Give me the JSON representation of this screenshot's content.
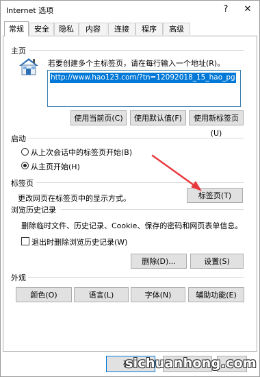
{
  "window": {
    "title": "Internet 选项",
    "help_label": "?",
    "close_label": "✕"
  },
  "tabs": [
    {
      "label": "常规",
      "active": true
    },
    {
      "label": "安全"
    },
    {
      "label": "隐私"
    },
    {
      "label": "内容"
    },
    {
      "label": "连接"
    },
    {
      "label": "程序"
    },
    {
      "label": "高级"
    }
  ],
  "homepage": {
    "section_title": "主页",
    "description": "若要创建多个主标签页，请在每行输入一个地址(R)。",
    "url": "http://www.hao123.com/?tn=12092018_15_hao_pg",
    "buttons": {
      "use_current": "使用当前页(C)",
      "use_default": "使用默认值(F)",
      "use_new_tab": "使用新标签页(U)"
    }
  },
  "startup": {
    "section_title": "启动",
    "options": [
      {
        "label": "从上次会话中的标签页开始(B)",
        "selected": false
      },
      {
        "label": "从主页开始(H)",
        "selected": true
      }
    ]
  },
  "tabs_section": {
    "section_title": "标签页",
    "description": "更改网页在标签页中的显示方式。",
    "button": "标签页(T)"
  },
  "history": {
    "section_title": "浏览历史记录",
    "description": "删除临时文件、历史记录、Cookie、保存的密码和网页表单信息。",
    "checkbox_label": "退出时删除浏览历史记录(W)",
    "checkbox_checked": false,
    "buttons": {
      "delete": "删除(D)...",
      "settings": "设置(S)"
    }
  },
  "appearance": {
    "section_title": "外观",
    "buttons": {
      "colors": "颜色(O)",
      "languages": "语言(L)",
      "fonts": "字体(N)",
      "accessibility": "辅助功能(E)"
    }
  },
  "footer": {
    "ok_partial": "确",
    "watermark": "sichuanhong.com"
  },
  "annotation": {
    "arrow_color": "#e8383d"
  }
}
